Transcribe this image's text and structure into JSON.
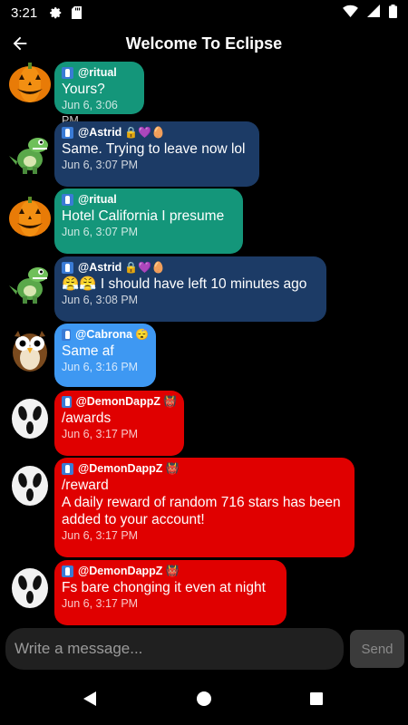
{
  "status_bar": {
    "time": "3:21",
    "icons": [
      "gear-icon",
      "sd-card-icon",
      "wifi-icon",
      "signal-icon",
      "battery-icon"
    ]
  },
  "header": {
    "title": "Welcome To Eclipse",
    "back_icon": "arrow-back-icon"
  },
  "messages": [
    {
      "avatar": "pumpkin",
      "color": "#14967a",
      "username": "@ritual",
      "decoration": "",
      "text": "Yours?",
      "time": "Jun 6, 3:06 PM"
    },
    {
      "avatar": "dinosaur",
      "color": "#1c3b66",
      "username": "@Astrid",
      "decoration": "🔒💜🥚",
      "text": "Same. Trying to leave now lol",
      "time": "Jun 6, 3:07 PM"
    },
    {
      "avatar": "pumpkin",
      "color": "#14967a",
      "username": "@ritual",
      "decoration": "",
      "text": "Hotel California I presume",
      "time": "Jun 6, 3:07 PM"
    },
    {
      "avatar": "dinosaur",
      "color": "#1c3b66",
      "username": "@Astrid",
      "decoration": "🔒💜🥚",
      "text": "😤😤 I should have left 10 minutes ago",
      "time": "Jun 6, 3:08 PM"
    },
    {
      "avatar": "owl",
      "color": "#3e98f2",
      "username": "@Cabrona",
      "decoration": "😴",
      "text": "Same af",
      "time": "Jun 6, 3:16 PM"
    },
    {
      "avatar": "ghost",
      "color": "#e00000",
      "username": "@DemonDappZ",
      "decoration": "👹",
      "text": "/awards",
      "time": "Jun 6, 3:17 PM"
    },
    {
      "avatar": "ghost",
      "color": "#e00000",
      "username": "@DemonDappZ",
      "decoration": "👹",
      "text": "/reward\nA daily reward of random 716 stars has been added to your account!",
      "time": "Jun 6, 3:17 PM"
    },
    {
      "avatar": "ghost",
      "color": "#e00000",
      "username": "@DemonDappZ",
      "decoration": "👹",
      "text": "Fs bare chonging it even at night",
      "time": "Jun 6, 3:17 PM"
    }
  ],
  "composer": {
    "placeholder": "Write a message...",
    "send_label": "Send"
  },
  "nav": {
    "back": "triangle-back-icon",
    "home": "circle-home-icon",
    "recents": "square-recents-icon"
  }
}
